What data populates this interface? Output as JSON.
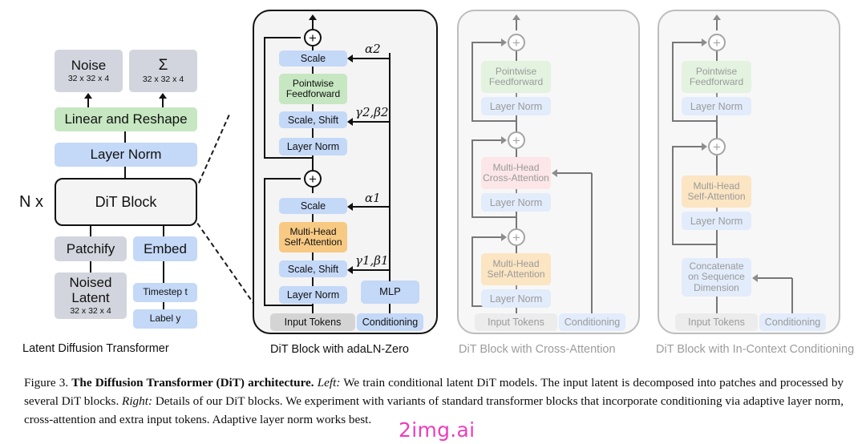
{
  "figure": {
    "number": "Figure 3.",
    "title": "The Diffusion Transformer (DiT) architecture.",
    "left_label": "Left:",
    "left_text": "We train conditional latent DiT models. The input latent is decomposed into patches and processed by several DiT blocks.",
    "right_label": "Right:",
    "right_text": "Details of our DiT blocks. We experiment with variants of standard transformer blocks that incorporate conditioning via adaptive layer norm, cross-attention and extra input tokens. Adaptive layer norm works best.",
    "watermark": "2img.ai"
  },
  "panels": {
    "left": {
      "caption": "Latent Diffusion Transformer",
      "repeat_label": "N x",
      "boxes": {
        "noise": {
          "label": "Noise",
          "shape": "32 x 32 x 4"
        },
        "sigma": {
          "label": "Σ",
          "shape": "32 x 32 x 4"
        },
        "linear_reshape": {
          "label": "Linear and Reshape"
        },
        "layer_norm": {
          "label": "Layer Norm"
        },
        "dit_block": {
          "label": "DiT Block"
        },
        "patchify": {
          "label": "Patchify"
        },
        "embed": {
          "label": "Embed"
        },
        "noised_latent": {
          "label1": "Noised",
          "label2": "Latent",
          "shape": "32 x 32 x 4"
        },
        "timestep": {
          "label": "Timestep t"
        },
        "classlabel": {
          "label": "Label y"
        }
      }
    },
    "adaln": {
      "caption": "DiT Block with adaLN-Zero",
      "boxes": {
        "scale2": "Scale",
        "pointwise_ff": {
          "label1": "Pointwise",
          "label2": "Feedforward"
        },
        "scale_shift2": "Scale, Shift",
        "layer_norm2": "Layer Norm",
        "scale1": "Scale",
        "mhsa": {
          "label1": "Multi-Head",
          "label2": "Self-Attention"
        },
        "scale_shift1": "Scale, Shift",
        "layer_norm1": "Layer Norm",
        "mlp": "MLP",
        "input_tokens": "Input Tokens",
        "conditioning": "Conditioning"
      },
      "params": {
        "alpha2": "α2",
        "gamma_beta2": "γ2,β2",
        "alpha1": "α1",
        "gamma_beta1": "γ1,β1"
      },
      "plus_symbol": "+"
    },
    "cross": {
      "caption": "DiT Block with Cross-Attention",
      "boxes": {
        "pointwise_ff": {
          "label1": "Pointwise",
          "label2": "Feedforward"
        },
        "layer_norm3": "Layer Norm",
        "mhca": {
          "label1": "Multi-Head",
          "label2": "Cross-Attention"
        },
        "layer_norm2": "Layer Norm",
        "mhsa": {
          "label1": "Multi-Head",
          "label2": "Self-Attention"
        },
        "layer_norm1": "Layer Norm",
        "input_tokens": "Input Tokens",
        "conditioning": "Conditioning"
      },
      "plus_symbol": "+"
    },
    "incontext": {
      "caption": "DiT Block with In-Context Conditioning",
      "boxes": {
        "pointwise_ff": {
          "label1": "Pointwise",
          "label2": "Feedforward"
        },
        "layer_norm2": "Layer Norm",
        "mhsa": {
          "label1": "Multi-Head",
          "label2": "Self-Attention"
        },
        "layer_norm1": "Layer Norm",
        "concat": {
          "label1": "Concatenate",
          "label2": "on Sequence",
          "label3": "Dimension"
        },
        "input_tokens": "Input Tokens",
        "conditioning": "Conditioning"
      },
      "plus_symbol": "+"
    }
  },
  "colors": {
    "gray": "#d2d5dd",
    "green": "#c6e7c1",
    "blue": "#c4d8f7",
    "orange": "#f7c983",
    "red": "#f8ccce",
    "watermark": "#ee3dbd"
  }
}
